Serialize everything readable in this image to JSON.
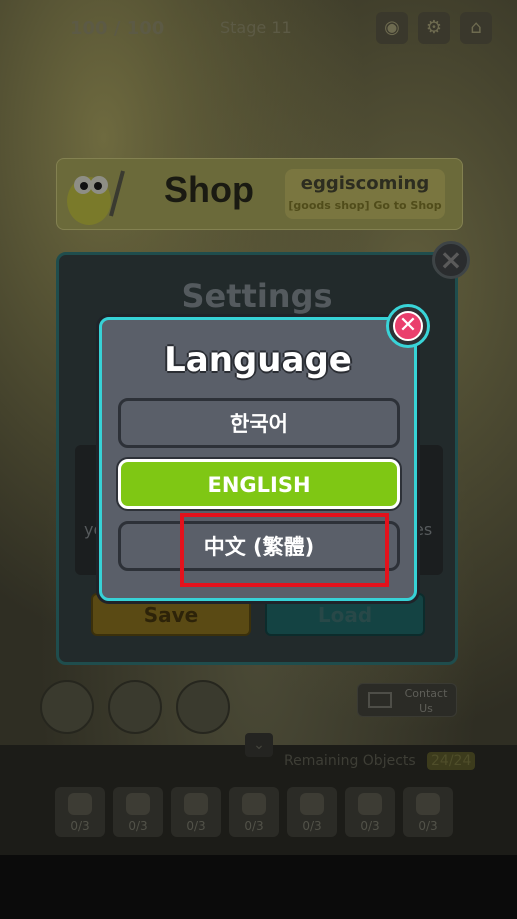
{
  "hud": {
    "hp": "100 / 100",
    "stage": "Stage 11"
  },
  "shop_banner": {
    "title": "Shop",
    "brand": "eggiscoming",
    "subtitle": "[goods shop] Go to Shop"
  },
  "settings": {
    "title": "Settings",
    "side_left": "yo",
    "side_right": "es",
    "save_label": "Save",
    "load_label": "Load"
  },
  "language_dialog": {
    "title": "Language",
    "options": [
      {
        "label": "한국어",
        "selected": false
      },
      {
        "label": "ENGLISH",
        "selected": true
      },
      {
        "label": "中文 (繁體)",
        "selected": false
      }
    ],
    "selected_color": "#7fc714",
    "border_color": "#37d2d6",
    "close_color": "#ea3f6d"
  },
  "highlight_color": "#e3121c",
  "contact": {
    "label": "Contact Us"
  },
  "bottom_bar": {
    "remaining_label": "Remaining Objects",
    "remaining_count": "24/24",
    "objects": [
      {
        "icon": "watermelon-icon",
        "count": "0/3"
      },
      {
        "icon": "bottle-icon",
        "count": "0/3"
      },
      {
        "icon": "bowl-icon",
        "count": "0/3"
      },
      {
        "icon": "sunglasses-icon",
        "count": "0/3"
      },
      {
        "icon": "jar-icon",
        "count": "0/3"
      },
      {
        "icon": "croissant-icon",
        "count": "0/3"
      },
      {
        "icon": "icecream-icon",
        "count": "0/3"
      }
    ]
  }
}
